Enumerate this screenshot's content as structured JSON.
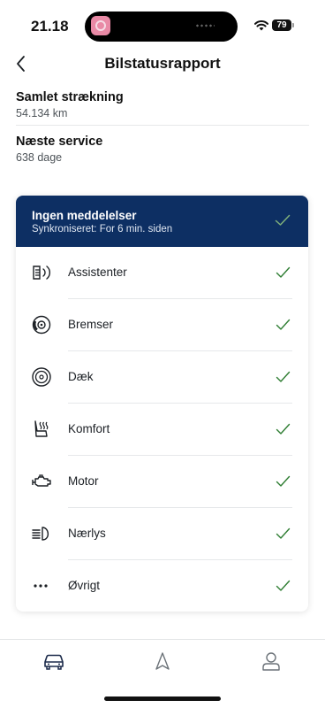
{
  "status_bar": {
    "time": "21.18",
    "battery": "79"
  },
  "header": {
    "title": "Bilstatusrapport"
  },
  "info": [
    {
      "label": "Samlet strækning",
      "value": "54.134 km"
    },
    {
      "label": "Næste service",
      "value": "638 dage"
    }
  ],
  "banner": {
    "title": "Ingen meddelelser",
    "subtitle": "Synkroniseret: For 6 min. siden"
  },
  "items": [
    {
      "label": "Assistenter",
      "icon": "driver-assist-icon"
    },
    {
      "label": "Bremser",
      "icon": "brake-icon"
    },
    {
      "label": "Dæk",
      "icon": "tire-icon"
    },
    {
      "label": "Komfort",
      "icon": "seat-heating-icon"
    },
    {
      "label": "Motor",
      "icon": "engine-icon"
    },
    {
      "label": "Nærlys",
      "icon": "low-beam-icon"
    },
    {
      "label": "Øvrigt",
      "icon": "more-dots-icon"
    }
  ],
  "tabbar": [
    "car-icon",
    "navigation-icon",
    "profile-icon"
  ],
  "colors": {
    "banner": "#0d2f63",
    "check": "#2e7d32",
    "text": "#1b1f24"
  }
}
